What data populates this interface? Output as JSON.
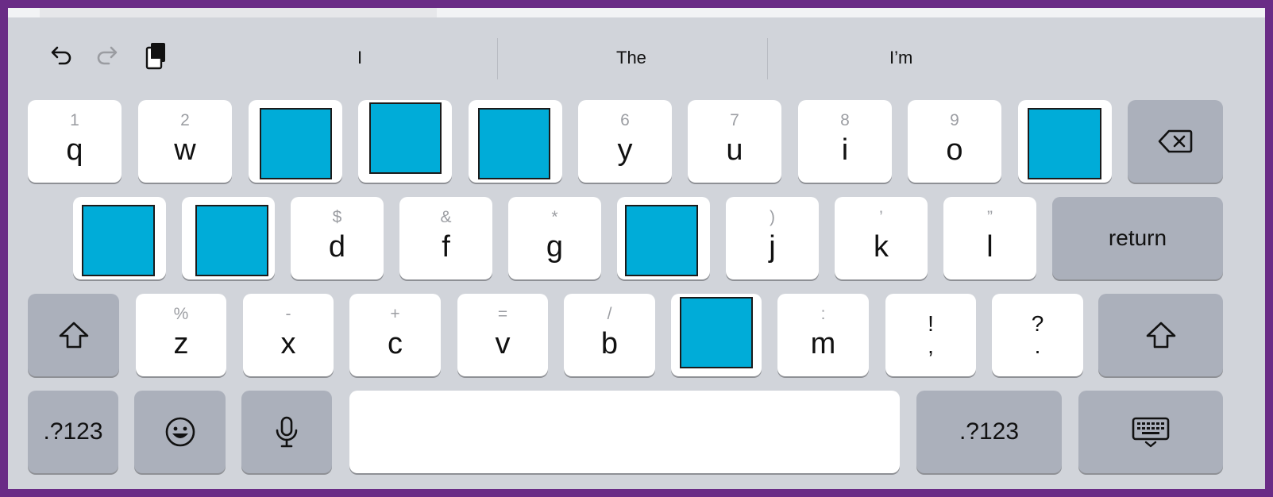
{
  "toolbar": {
    "undo_icon": "undo-icon",
    "redo_icon": "redo-icon",
    "paste_icon": "clipboard-icon",
    "suggestions": [
      "I",
      "The",
      "I’m"
    ]
  },
  "row1": [
    {
      "hint": "1",
      "main": "q"
    },
    {
      "hint": "2",
      "main": "w"
    },
    {
      "masked": true
    },
    {
      "masked": true
    },
    {
      "masked": true
    },
    {
      "hint": "6",
      "main": "y"
    },
    {
      "hint": "7",
      "main": "u"
    },
    {
      "hint": "8",
      "main": "i"
    },
    {
      "hint": "9",
      "main": "o"
    },
    {
      "masked": true
    }
  ],
  "row2": [
    {
      "masked": true
    },
    {
      "masked": true
    },
    {
      "hint": "$",
      "main": "d"
    },
    {
      "hint": "&",
      "main": "f"
    },
    {
      "hint": "*",
      "main": "g"
    },
    {
      "masked": true
    },
    {
      "hint": ")",
      "main": "j"
    },
    {
      "hint": "’",
      "main": "k"
    },
    {
      "hint": "”",
      "main": "l"
    }
  ],
  "row3": [
    {
      "hint": "%",
      "main": "z"
    },
    {
      "hint": "-",
      "main": "x"
    },
    {
      "hint": "+",
      "main": "c"
    },
    {
      "hint": "=",
      "main": "v"
    },
    {
      "hint": "/",
      "main": "b"
    },
    {
      "masked": true
    },
    {
      "hint": ":",
      "main": "m"
    }
  ],
  "punct": {
    "exclam_top": "!",
    "exclam_bottom": ",",
    "question_top": "?",
    "question_bottom": "."
  },
  "return_label": "return",
  "numbers_label_left": ".?123",
  "numbers_label_right": ".?123",
  "colors": {
    "mask": "#00acd8",
    "frame": "#6a2c86",
    "keyboard_bg": "#d1d4da"
  }
}
